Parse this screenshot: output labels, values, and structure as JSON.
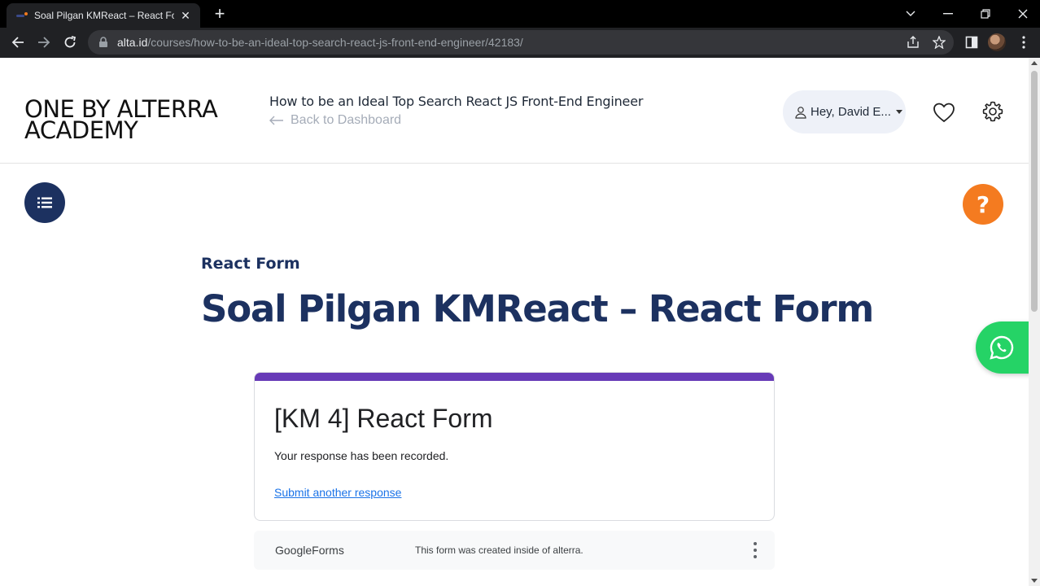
{
  "browser": {
    "tab_title": "Soal Pilgan KMReact – React Form",
    "tab_close": "✕",
    "new_tab": "+",
    "url_host": "alta.id",
    "url_path": "/courses/how-to-be-an-ideal-top-search-react-js-front-end-engineer/42183/"
  },
  "header": {
    "logo_line1": "ONE BY ALTERRA",
    "logo_line2": "ACADEMY",
    "course_title": "How to be an Ideal Top Search React JS Front-End Engineer",
    "back_label": "Back to Dashboard",
    "user_greeting": "Hey, David E..."
  },
  "lesson": {
    "section": "React Form",
    "title": "Soal Pilgan KMReact – React Form"
  },
  "form": {
    "title": "[KM 4] React Form",
    "message": "Your response has been recorded.",
    "link": "Submit another response",
    "accent_color": "#673ab7"
  },
  "footer": {
    "logo_google": "Google",
    "logo_forms": "Forms",
    "note": "This form was created inside of alterra."
  },
  "help_label": "?",
  "colors": {
    "brand_navy": "#1c3160",
    "help_orange": "#f47b20",
    "whatsapp_green": "#25d366"
  }
}
